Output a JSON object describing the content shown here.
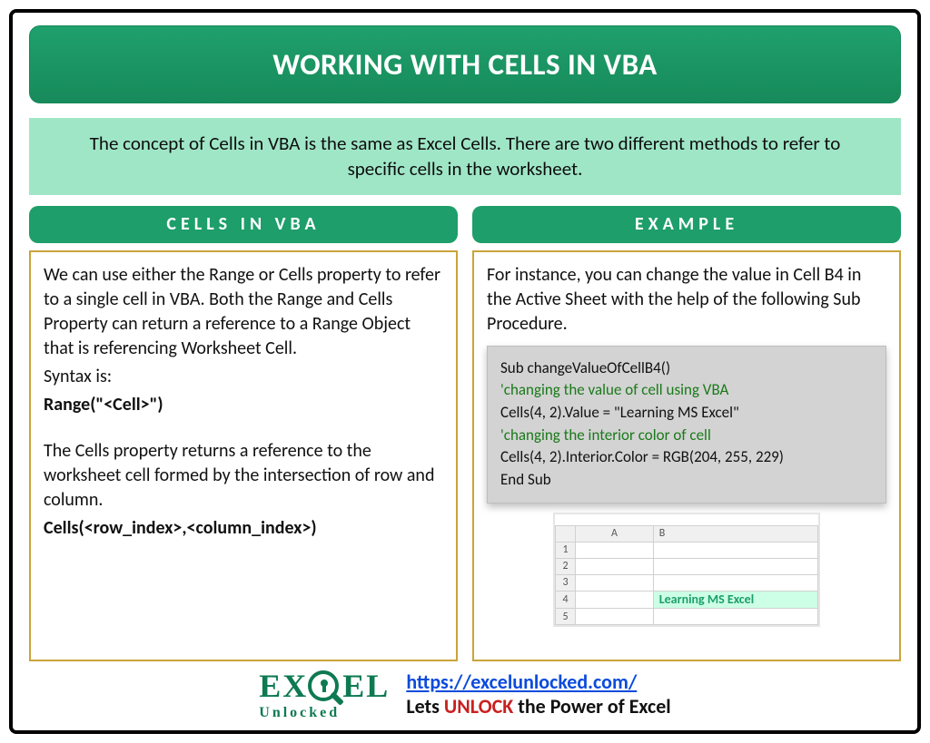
{
  "title": "WORKING WITH CELLS IN VBA",
  "intro": "The concept of Cells in VBA is the same as Excel Cells. There are two different methods to refer to specific cells in the worksheet.",
  "left": {
    "header": "CELLS IN VBA",
    "para1": "We can use either the Range or Cells property to refer to a single cell in VBA. Both the Range and Cells Property can return a reference to a Range Object that is referencing Worksheet Cell.",
    "syntax_label": "Syntax is:",
    "range_syntax": "Range(\"<Cell>\")",
    "para2": "The Cells property returns a reference to the worksheet cell formed by the intersection of row and column.",
    "cells_syntax": "Cells(<row_index>,<column_index>)"
  },
  "right": {
    "header": "EXAMPLE",
    "intro": "For instance, you can change the value in Cell B4 in the Active Sheet with the help of the following Sub Procedure.",
    "code": {
      "l1": "Sub changeValueOfCellB4()",
      "l2": "'changing the value of cell using VBA",
      "l3": "Cells(4, 2).Value = \"Learning MS Excel\"",
      "l4": "'changing the interior color of cell",
      "l5": "Cells(4, 2).Interior.Color = RGB(204, 255, 229)",
      "l6": "End Sub"
    },
    "sheet": {
      "colA": "A",
      "colB": "B",
      "rows": [
        "1",
        "2",
        "3",
        "4",
        "5"
      ],
      "b4_value": "Learning MS Excel"
    }
  },
  "footer": {
    "logo_main": "EXCEL",
    "logo_sub": "Unlocked",
    "link": "https://excelunlocked.com/",
    "tagline_pre": "Lets ",
    "tagline_unlock": "UNLOCK",
    "tagline_post": " the Power of Excel"
  }
}
